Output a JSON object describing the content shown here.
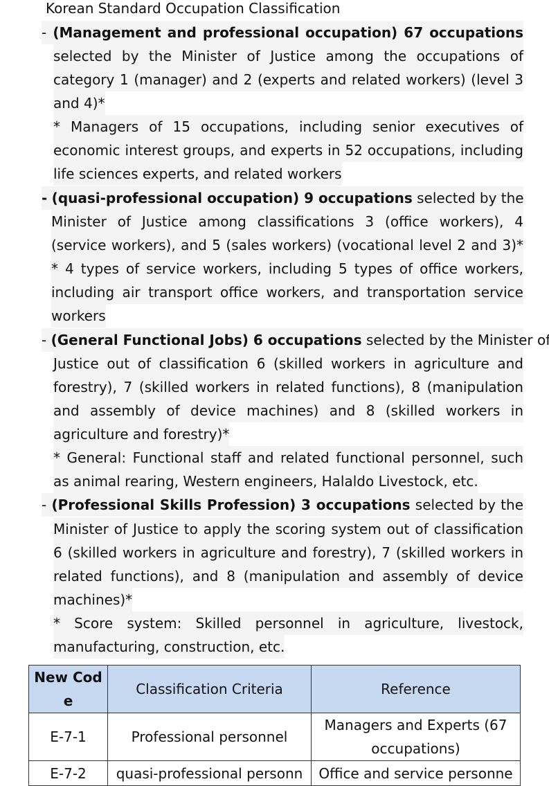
{
  "heading": "Korean Standard Occupation Classification",
  "sections": [
    {
      "id": "management",
      "dash": "-",
      "bold_label": "(Management and professional occupation) 67 occupations",
      "lines": [
        "selected by the Minister of Justice among the occupations of",
        "category 1 (manager) and 2 (experts and related workers) (level 3",
        "and 4)*"
      ],
      "note_lines": [
        "* Managers of 15 occupations, including senior executives of",
        "economic interest groups, and experts in 52 occupations, including",
        "life sciences experts, and related workers"
      ]
    },
    {
      "id": "quasi",
      "dash": "-",
      "bold_label": "(quasi-professional occupation) 9 occupations",
      "first_tail": "selected by the",
      "lines": [
        "Minister of Justice among classifications 3 (office workers), 4",
        "(service workers), and 5 (sales workers) (vocational level 2 and 3)*"
      ],
      "note_lines": [
        "* 4 types of service workers, including 5 types of office workers,",
        "including air transport office workers, and transportation service",
        "workers"
      ]
    },
    {
      "id": "general",
      "dash": "-",
      "bold_label": "(General Functional Jobs) 6 occupations",
      "first_tail": "selected by the Minister of",
      "lines": [
        "Justice out of classification 6 (skilled workers in agriculture and",
        "forestry), 7 (skilled workers in related functions), 8 (manipulation",
        "and assembly of device machines) and 8 (skilled workers in",
        "agriculture and forestry)*"
      ],
      "note_lines": [
        "* General: Functional staff and related functional personnel, such",
        "as animal rearing, Western engineers, Halaldo Livestock, etc."
      ]
    },
    {
      "id": "skills",
      "dash": "-",
      "bold_label": "(Professional Skills Profession) 3 occupations",
      "first_tail": "selected by the",
      "lines": [
        "Minister of Justice to apply the scoring system out of classification",
        "6 (skilled workers in agriculture and forestry), 7 (skilled workers in",
        "related functions), and 8 (manipulation and assembly of device",
        "machines)*"
      ],
      "note_lines": [
        "* Score system: Skilled personnel in agriculture, livestock,",
        "manufacturing, construction, etc."
      ]
    }
  ],
  "table": {
    "headers": [
      "New Cod\ne",
      "Classification Criteria",
      "Reference"
    ],
    "rows": [
      [
        "E-7-1",
        "Professional personnel",
        "Managers and Experts (67\noccupations)"
      ],
      [
        "E-7-2",
        "quasi-professional personn",
        "Office and service personne"
      ]
    ]
  }
}
